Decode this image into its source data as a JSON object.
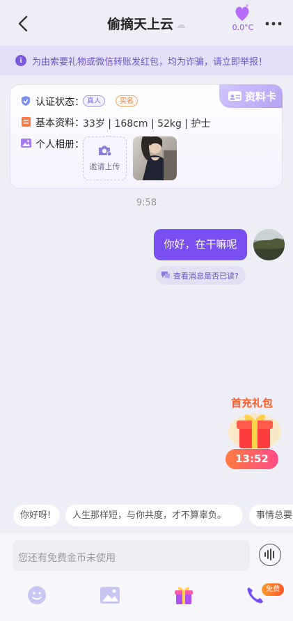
{
  "header": {
    "title": "偷摘天上云",
    "cloud_icon": "cloud-icon",
    "temperature": "0.0°C",
    "heart_color": "#b66cf5"
  },
  "warning": {
    "icon_glyph": "i",
    "text": "为由索要礼物或微信转账发红包，均为诈骗，请立即举报！"
  },
  "profile_card": {
    "tab_label": "资料卡",
    "verify_label": "认证状态：",
    "badges": [
      "真人",
      "实名"
    ],
    "basic_label": "基本资料：",
    "basic_info": "33岁 | 168cm | 52kg | 护士",
    "album_label": "个人相册：",
    "upload_label": "邀请上传"
  },
  "chat": {
    "time": "9:58",
    "message": "你好，在干嘛呢",
    "read_check": "查看消息是否已读?"
  },
  "gift": {
    "title": "首充礼包",
    "timer": "13:52"
  },
  "quick_replies": [
    "你好呀!",
    "人生那样短，与你共度，才不算辜负。",
    "事情总要"
  ],
  "input": {
    "placeholder": "您还有免费金币未使用",
    "free_badge": "免费"
  },
  "colors": {
    "accent": "#7a4ff2",
    "background": "#eeeef7"
  }
}
